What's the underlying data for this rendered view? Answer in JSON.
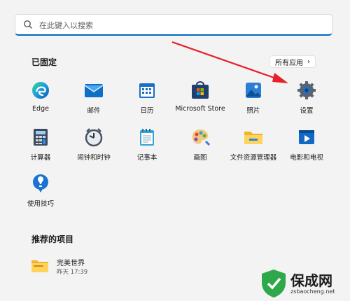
{
  "search": {
    "placeholder": "在此键入以搜索",
    "icon": "search-icon"
  },
  "pinned": {
    "title": "已固定",
    "all_apps_label": "所有应用",
    "apps": [
      {
        "label": "Edge",
        "icon": "edge-icon"
      },
      {
        "label": "邮件",
        "icon": "mail-icon"
      },
      {
        "label": "日历",
        "icon": "calendar-icon"
      },
      {
        "label": "Microsoft Store",
        "icon": "store-icon"
      },
      {
        "label": "照片",
        "icon": "photos-icon"
      },
      {
        "label": "设置",
        "icon": "settings-gear-icon"
      },
      {
        "label": "计算器",
        "icon": "calculator-icon"
      },
      {
        "label": "闹钟和时钟",
        "icon": "clock-icon"
      },
      {
        "label": "记事本",
        "icon": "notepad-icon"
      },
      {
        "label": "画图",
        "icon": "paint-icon"
      },
      {
        "label": "文件资源管理器",
        "icon": "folder-icon"
      },
      {
        "label": "电影和电视",
        "icon": "movies-icon"
      },
      {
        "label": "使用技巧",
        "icon": "tips-icon"
      }
    ]
  },
  "recommended": {
    "title": "推荐的项目",
    "items": [
      {
        "name": "完美世界",
        "time": "昨天 17:39",
        "icon": "folder-icon"
      }
    ]
  },
  "watermark": {
    "text": "保成网",
    "sub": "zsbaocheng.net"
  },
  "colors": {
    "accent": "#0067c0",
    "arrow": "#e8202a"
  }
}
